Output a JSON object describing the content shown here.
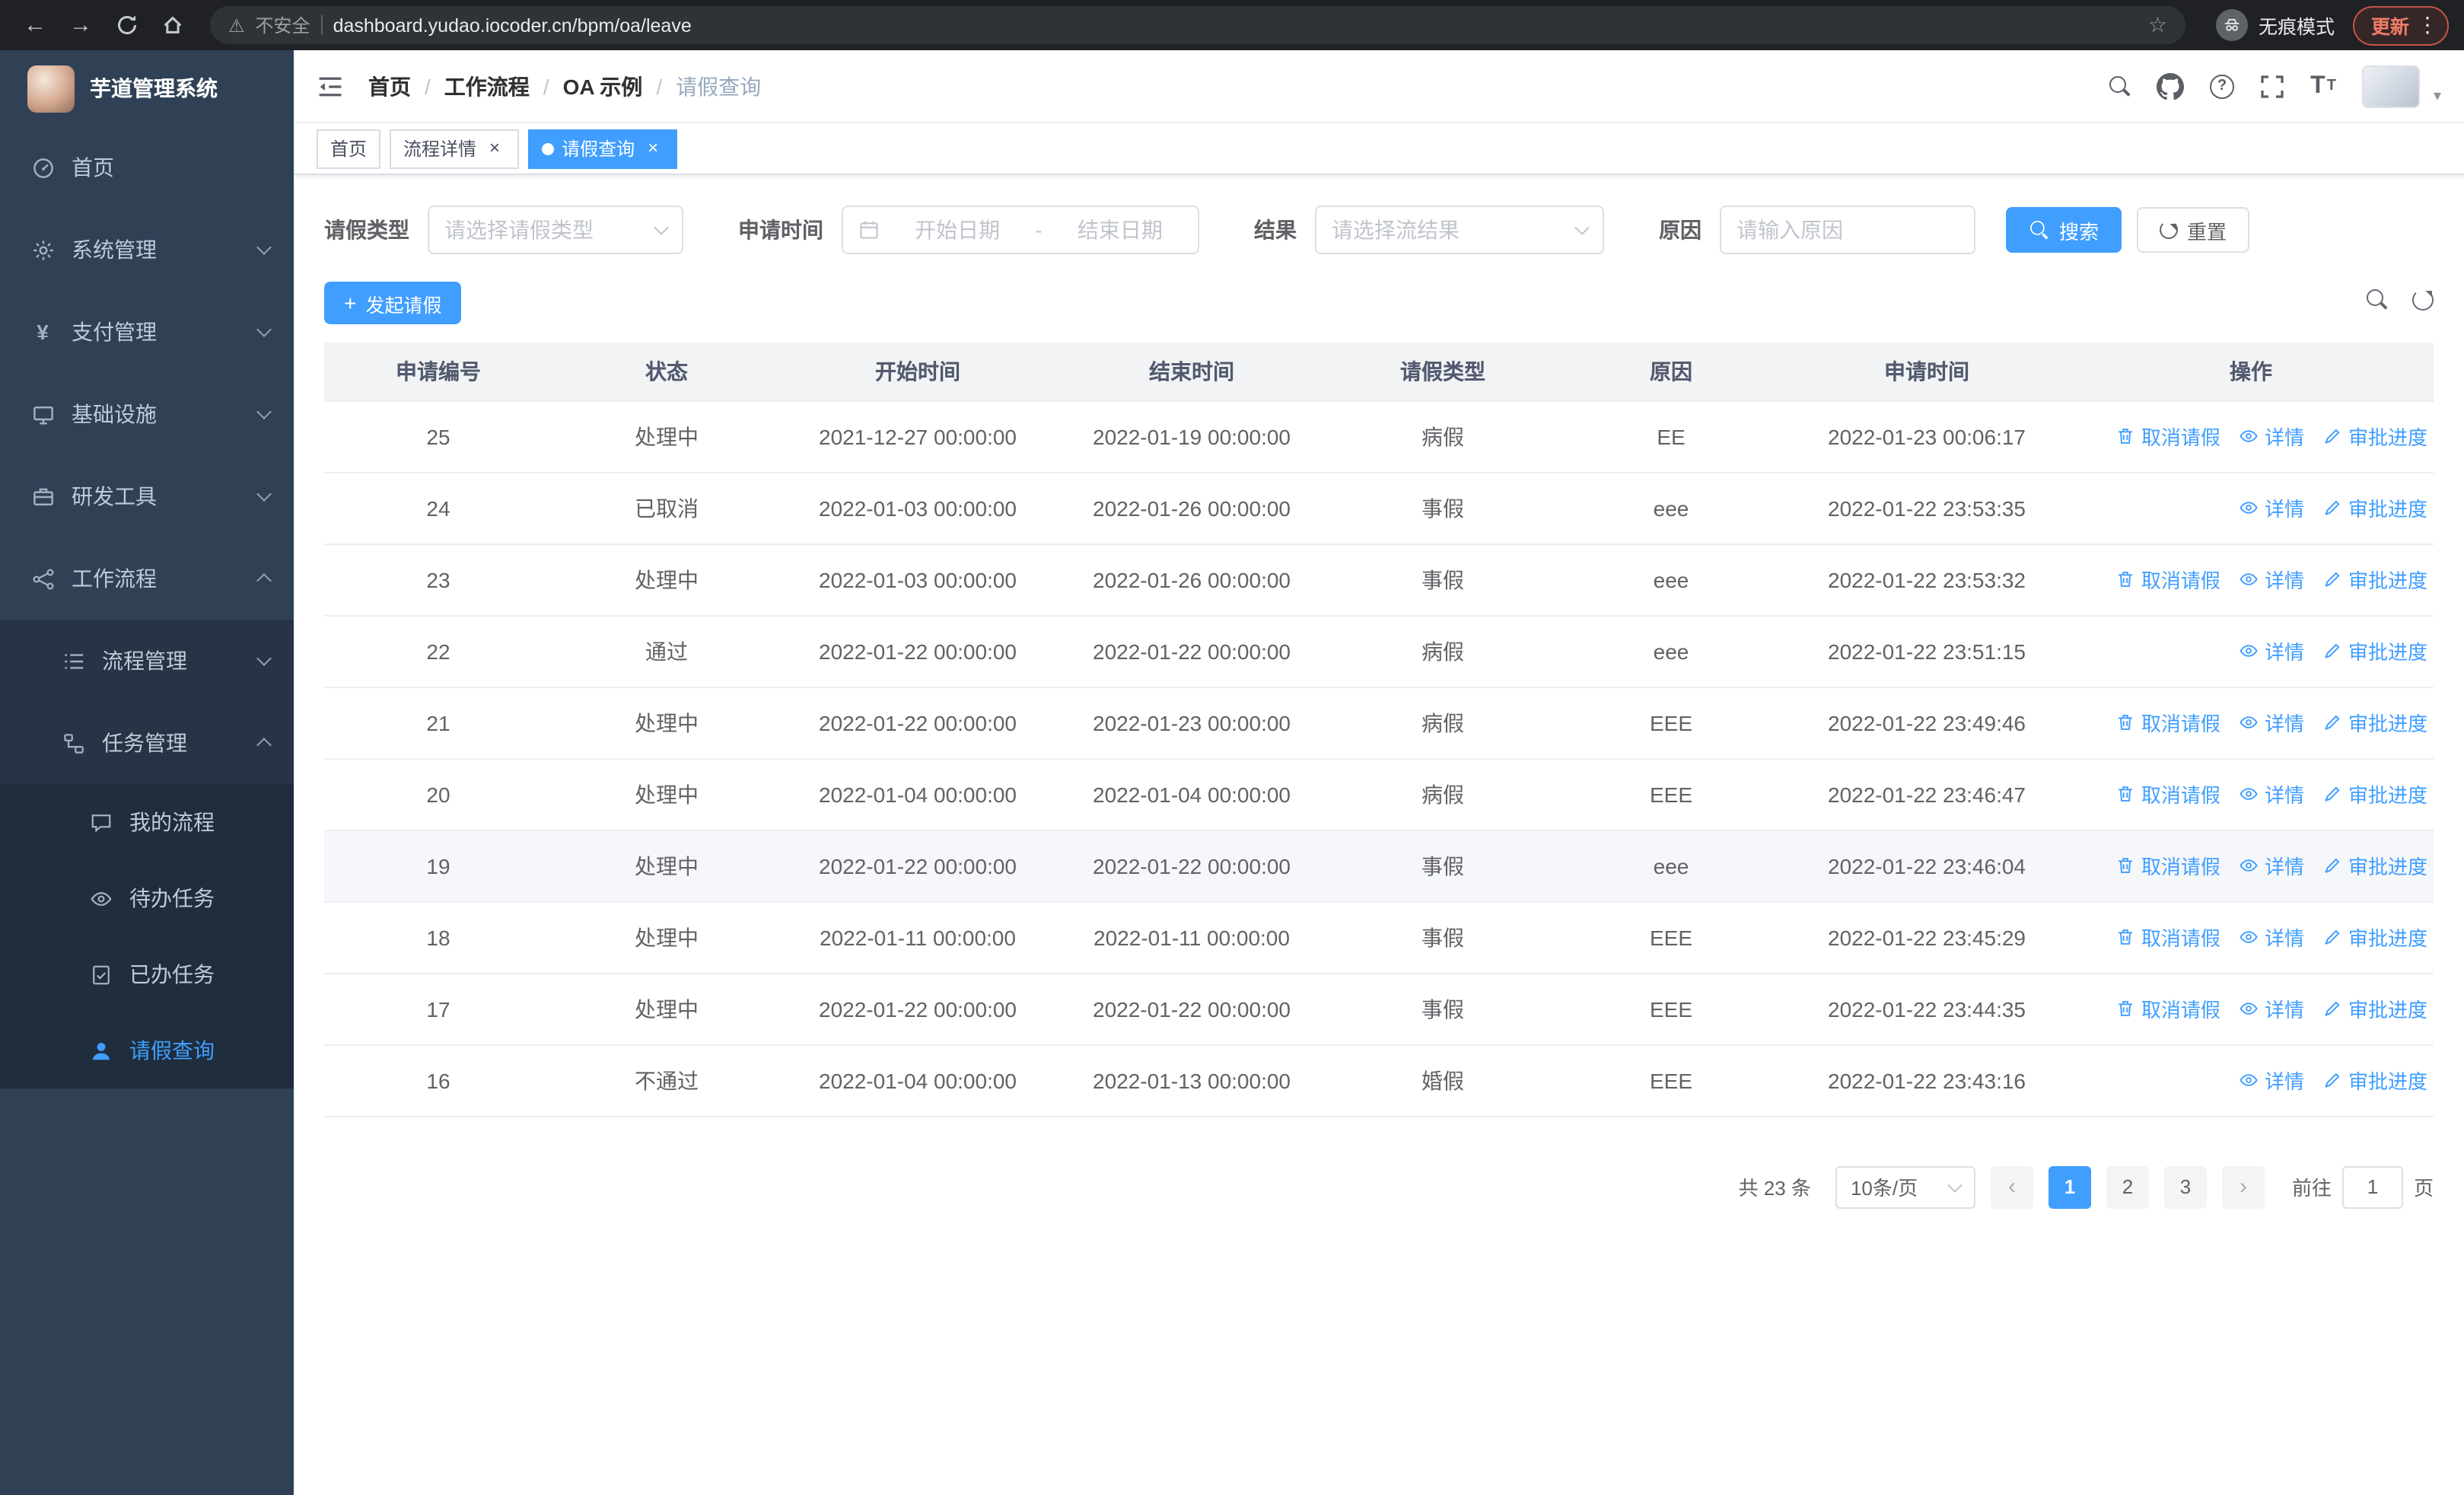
{
  "browser": {
    "security_label": "不安全",
    "url": "dashboard.yudao.iocoder.cn/bpm/oa/leave",
    "incognito_label": "无痕模式",
    "update_label": "更新"
  },
  "sidebar": {
    "logo_title": "芋道管理系统",
    "items": [
      {
        "label": "首页"
      },
      {
        "label": "系统管理"
      },
      {
        "label": "支付管理"
      },
      {
        "label": "基础设施"
      },
      {
        "label": "研发工具"
      },
      {
        "label": "工作流程",
        "children": [
          {
            "label": "流程管理"
          },
          {
            "label": "任务管理",
            "children": [
              {
                "label": "我的流程"
              },
              {
                "label": "待办任务"
              },
              {
                "label": "已办任务"
              },
              {
                "label": "请假查询"
              }
            ]
          }
        ]
      }
    ]
  },
  "header": {
    "breadcrumb": [
      "首页",
      "工作流程",
      "OA 示例",
      "请假查询"
    ],
    "breadcrumb_separator": "/"
  },
  "tags": [
    {
      "label": "首页"
    },
    {
      "label": "流程详情"
    },
    {
      "label": "请假查询"
    }
  ],
  "filters": {
    "leave_type_label": "请假类型",
    "leave_type_placeholder": "请选择请假类型",
    "apply_time_label": "申请时间",
    "start_placeholder": "开始日期",
    "range_separator": "-",
    "end_placeholder": "结束日期",
    "result_label": "结果",
    "result_placeholder": "请选择流结果",
    "reason_label": "原因",
    "reason_placeholder": "请输入原因",
    "search_label": "搜索",
    "reset_label": "重置"
  },
  "toolbar": {
    "create_label": "发起请假"
  },
  "table": {
    "columns": [
      "申请编号",
      "状态",
      "开始时间",
      "结束时间",
      "请假类型",
      "原因",
      "申请时间",
      "操作"
    ],
    "action_labels": {
      "cancel": "取消请假",
      "detail": "详情",
      "progress": "审批进度"
    },
    "rows": [
      {
        "id": "25",
        "status": "处理中",
        "start": "2021-12-27 00:00:00",
        "end": "2022-01-19 00:00:00",
        "type": "病假",
        "reason": "EE",
        "apply": "2022-01-23 00:06:17",
        "can_cancel": true,
        "highlighted": false
      },
      {
        "id": "24",
        "status": "已取消",
        "start": "2022-01-03 00:00:00",
        "end": "2022-01-26 00:00:00",
        "type": "事假",
        "reason": "eee",
        "apply": "2022-01-22 23:53:35",
        "can_cancel": false,
        "highlighted": false
      },
      {
        "id": "23",
        "status": "处理中",
        "start": "2022-01-03 00:00:00",
        "end": "2022-01-26 00:00:00",
        "type": "事假",
        "reason": "eee",
        "apply": "2022-01-22 23:53:32",
        "can_cancel": true,
        "highlighted": false
      },
      {
        "id": "22",
        "status": "通过",
        "start": "2022-01-22 00:00:00",
        "end": "2022-01-22 00:00:00",
        "type": "病假",
        "reason": "eee",
        "apply": "2022-01-22 23:51:15",
        "can_cancel": false,
        "highlighted": false
      },
      {
        "id": "21",
        "status": "处理中",
        "start": "2022-01-22 00:00:00",
        "end": "2022-01-23 00:00:00",
        "type": "病假",
        "reason": "EEE",
        "apply": "2022-01-22 23:49:46",
        "can_cancel": true,
        "highlighted": false
      },
      {
        "id": "20",
        "status": "处理中",
        "start": "2022-01-04 00:00:00",
        "end": "2022-01-04 00:00:00",
        "type": "病假",
        "reason": "EEE",
        "apply": "2022-01-22 23:46:47",
        "can_cancel": true,
        "highlighted": false
      },
      {
        "id": "19",
        "status": "处理中",
        "start": "2022-01-22 00:00:00",
        "end": "2022-01-22 00:00:00",
        "type": "事假",
        "reason": "eee",
        "apply": "2022-01-22 23:46:04",
        "can_cancel": true,
        "highlighted": true
      },
      {
        "id": "18",
        "status": "处理中",
        "start": "2022-01-11 00:00:00",
        "end": "2022-01-11 00:00:00",
        "type": "事假",
        "reason": "EEE",
        "apply": "2022-01-22 23:45:29",
        "can_cancel": true,
        "highlighted": false
      },
      {
        "id": "17",
        "status": "处理中",
        "start": "2022-01-22 00:00:00",
        "end": "2022-01-22 00:00:00",
        "type": "事假",
        "reason": "EEE",
        "apply": "2022-01-22 23:44:35",
        "can_cancel": true,
        "highlighted": false
      },
      {
        "id": "16",
        "status": "不通过",
        "start": "2022-01-04 00:00:00",
        "end": "2022-01-13 00:00:00",
        "type": "婚假",
        "reason": "EEE",
        "apply": "2022-01-22 23:43:16",
        "can_cancel": false,
        "highlighted": false
      }
    ]
  },
  "pagination": {
    "total_text": "共 23 条",
    "page_size_text": "10条/页",
    "pages": [
      "1",
      "2",
      "3"
    ],
    "active_page": "1",
    "goto_label": "前往",
    "goto_value": "1",
    "unit_label": "页"
  },
  "colors": {
    "accent": "#409eff",
    "sidebar_bg": "#304156",
    "submenu_bg": "#263445"
  }
}
